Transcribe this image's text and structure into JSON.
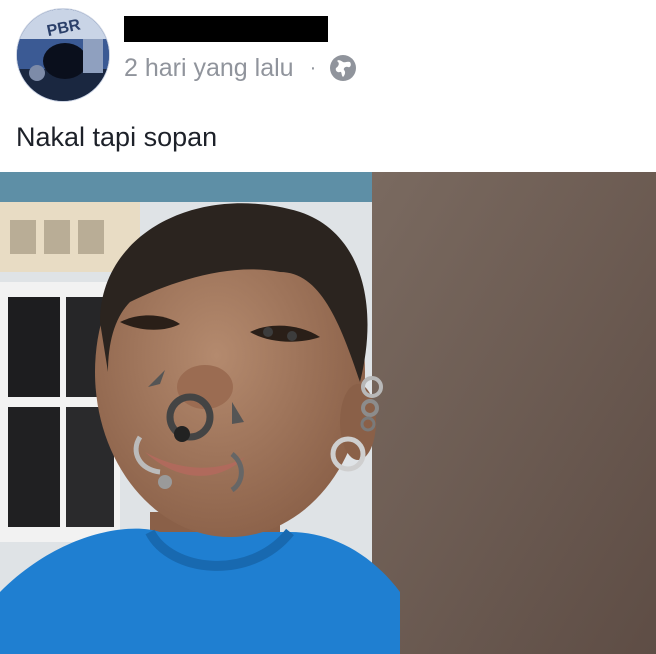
{
  "post": {
    "timestamp": "2 hari yang lalu",
    "separator": "·",
    "caption": "Nakal tapi sopan",
    "avatar_logo_text": "PBR",
    "privacy_icon": "globe-icon"
  }
}
